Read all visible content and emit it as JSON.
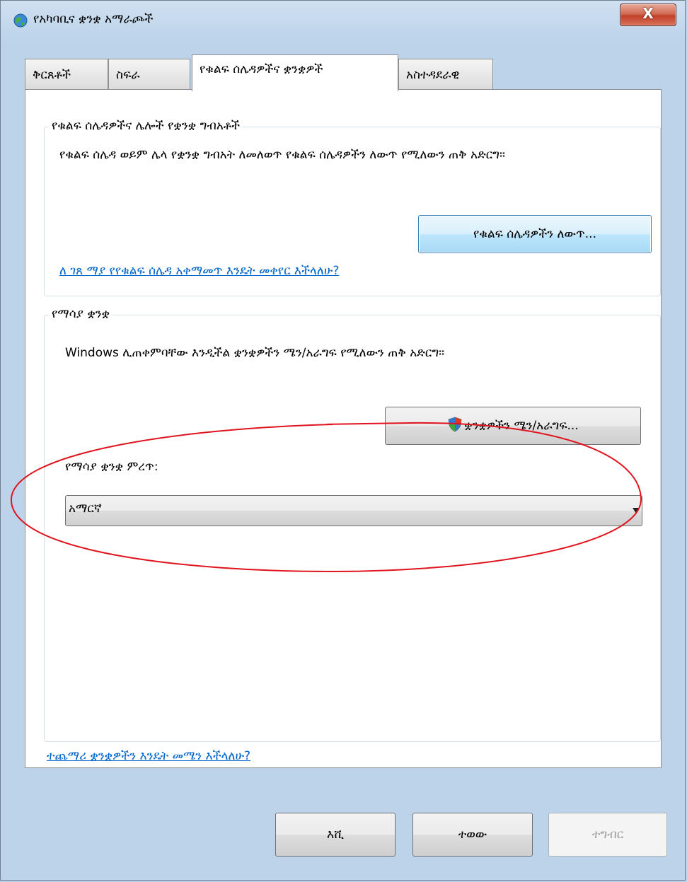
{
  "window": {
    "title": "የአካባቢና ቋንቋ አማራጮች",
    "close_label": "X"
  },
  "tabs": [
    {
      "label": "ቅርጸቶች"
    },
    {
      "label": "ስፍራ"
    },
    {
      "label": "የቁልፍ ሰሌዳዎችና ቋንቋዎች"
    },
    {
      "label": "አስተዳደራዊ"
    }
  ],
  "keyboards_group": {
    "title": "የቁልፍ ሰሌዳዎችና  ሌሎች የቋንቋ ግብአቶች",
    "description": "የቁልፍ ሰሌዳ ወይም ሌላ የቋንቋ ግብአት ለመለወጥ የቁልፍ ሰሌዳዎችን ለውጥ የሚለውን ጠቅ አድርግ።",
    "change_button": "የቁልፍ ሰሌዳዎችን ለውጥ...",
    "help_link": "ለ ገጸ ማያ የየቁልፍ ሰሌዳ አቀማመጥ እንዴት መቀየር እችላለሁ?"
  },
  "display_language_group": {
    "title": "የማሳያ ቋንቋ",
    "description": "Windows  ሊጠቀምባቸው እንዲችል ቋንቋዎችን ሜን/አራግፍ የሚለውን ጠቅ አድርግ።",
    "install_button": "ቋንቋዎችን ሜን/አራግፍ...",
    "choose_label": "የማሳያ ቋንቋ ምረጥ:",
    "selected_language": "አማርኛ"
  },
  "more_languages_link": "ተጨማሪ ቋንቋዎችን እንዴት መሜን እችላለሁ?",
  "footer": {
    "ok": "እሺ",
    "cancel": "ተወው",
    "apply": "ተግብር"
  },
  "colors": {
    "link": "#0066cc",
    "annotation": "#e0141e"
  }
}
